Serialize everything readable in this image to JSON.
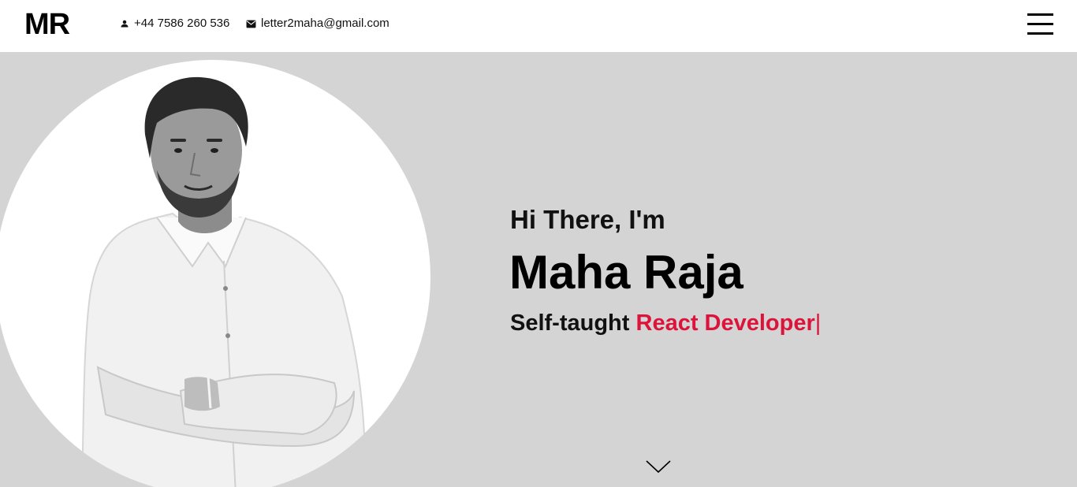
{
  "header": {
    "logo": "MR",
    "phone": "+44 7586 260 536",
    "email": "letter2maha@gmail.com",
    "phone_icon": "person-icon",
    "email_icon": "mail-icon",
    "menu_icon": "hamburger-menu-icon"
  },
  "hero": {
    "greeting": "Hi There, I'm",
    "name": "Maha Raja",
    "role_prefix": "Self-taught",
    "role_highlight": "React Developer",
    "role_cursor": "|",
    "scroll_icon": "chevron-down-icon"
  },
  "colors": {
    "accent": "#dc143c",
    "hero_background": "#d4d4d4",
    "header_background": "#ffffff"
  }
}
